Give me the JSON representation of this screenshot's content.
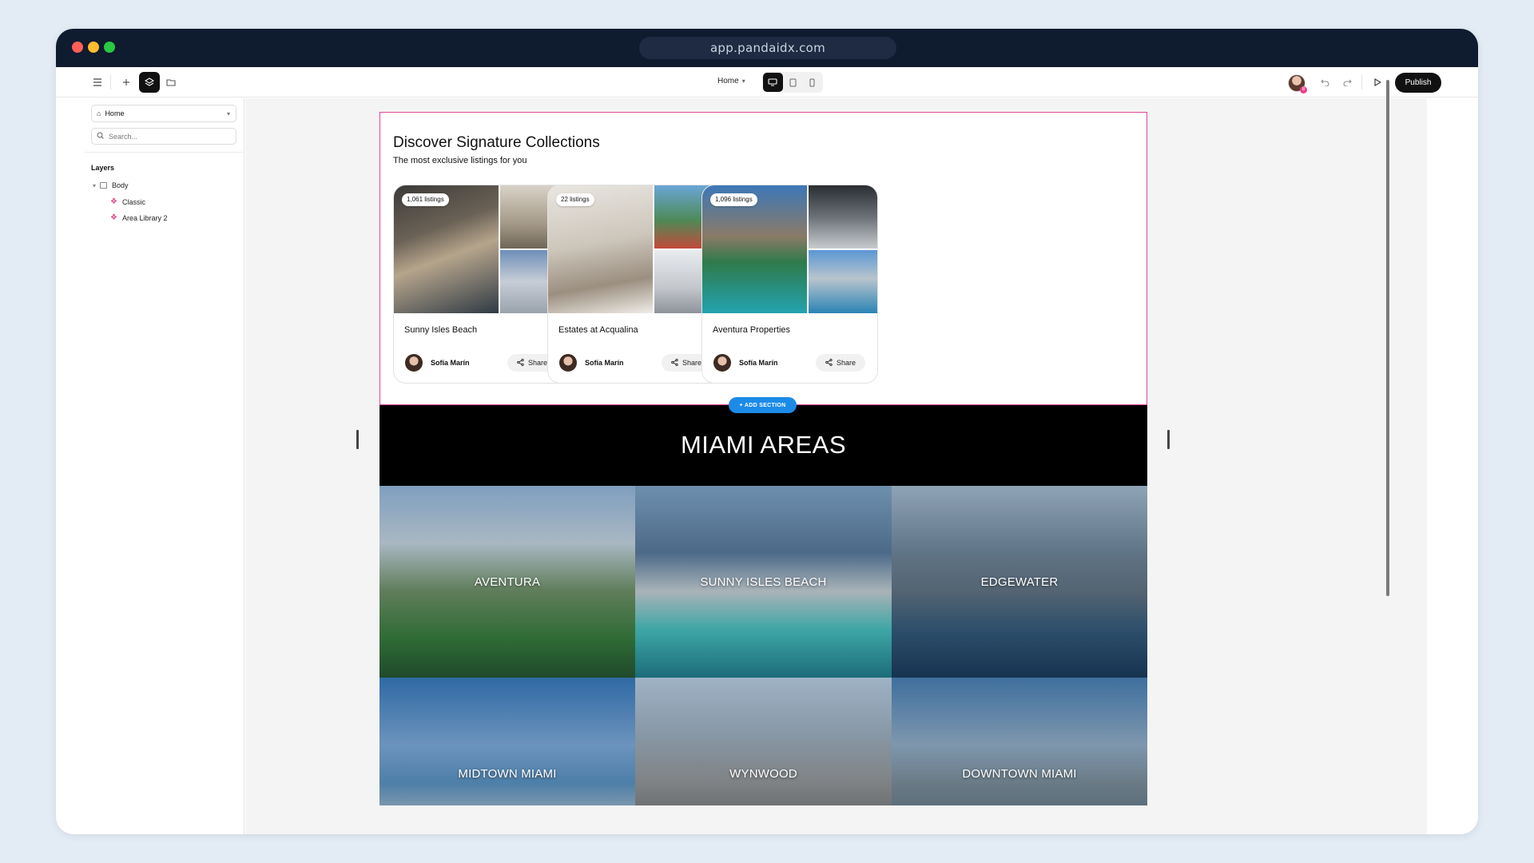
{
  "browser": {
    "url": "app.pandaidx.com"
  },
  "toolbar": {
    "page_select": "Home",
    "publish_label": "Publish",
    "avatar_badge": "8"
  },
  "sidebar": {
    "page_select": "Home",
    "search_placeholder": "Search...",
    "layers_title": "Layers",
    "tree": {
      "body": "Body",
      "classic": "Classic",
      "area_library": "Area Library 2"
    }
  },
  "collections": {
    "title": "Discover Signature Collections",
    "subtitle": "The most exclusive listings for you",
    "cards": [
      {
        "badge": "1,061 listings",
        "title": "Sunny Isles Beach",
        "agent": "Sofía Marín",
        "share": "Share"
      },
      {
        "badge": "22 listings",
        "title": "Estates at Acqualina",
        "agent": "Sofía Marín",
        "share": "Share"
      },
      {
        "badge": "1,096 listings",
        "title": "Aventura Properties",
        "agent": "Sofía Marín",
        "share": "Share"
      }
    ]
  },
  "add_section_label": "+  ADD SECTION",
  "areas": {
    "title": "MIAMI AREAS",
    "items": [
      "AVENTURA",
      "SUNNY ISLES BEACH",
      "EDGEWATER",
      "MIDTOWN MIAMI",
      "WYNWOOD",
      "DOWNTOWN MIAMI"
    ]
  },
  "colors": {
    "accent_pink": "#e0469a",
    "add_section_blue": "#1c8be8",
    "chrome": "#0f1b2f"
  },
  "icons": [
    "menu-icon",
    "plus-icon",
    "layers-icon",
    "folder-icon",
    "desktop-icon",
    "tablet-icon",
    "mobile-icon",
    "undo-icon",
    "redo-icon",
    "play-icon",
    "home-icon",
    "search-icon",
    "share-icon"
  ]
}
